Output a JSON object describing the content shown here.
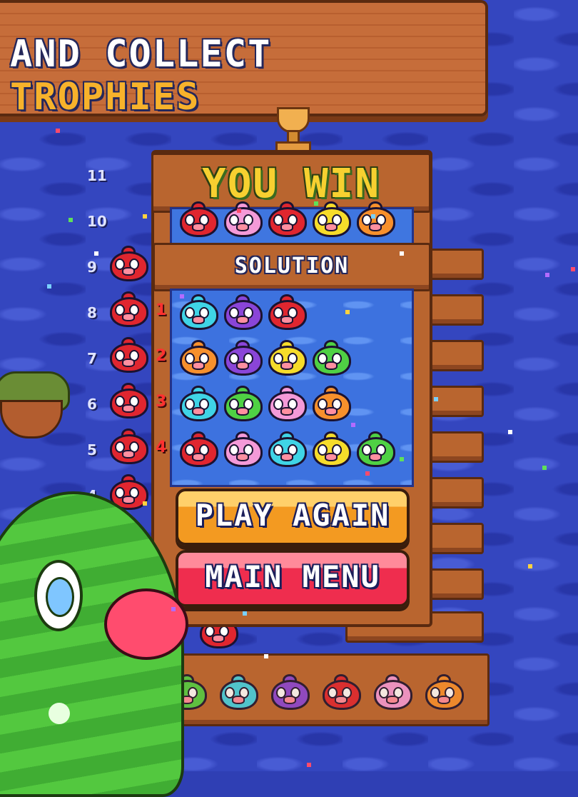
{
  "banner": {
    "text_plain": "AND COLLECT",
    "text_highlight": "TROPHIES"
  },
  "board": {
    "win_text": "YOU WIN",
    "solution_label": "SOLUTION",
    "answer_fish": [
      "red",
      "pink",
      "red",
      "yellow",
      "orange"
    ],
    "grid_rows": [
      {
        "rank": "1",
        "fish": [
          "cyan",
          "purple",
          "red"
        ]
      },
      {
        "rank": "2",
        "fish": [
          "orange",
          "purple",
          "yellow",
          "green"
        ]
      },
      {
        "rank": "3",
        "fish": [
          "cyan",
          "green",
          "pink",
          "orange"
        ]
      },
      {
        "rank": "4",
        "fish": [
          "red",
          "pink",
          "cyan",
          "yellow",
          "green"
        ]
      }
    ]
  },
  "row_numbers": [
    "11",
    "10",
    "9",
    "8",
    "7",
    "6",
    "5",
    "4"
  ],
  "buttons": {
    "play_again": "PLAY AGAIN",
    "main_menu": "MAIN MENU"
  },
  "palette_fish": [
    "green",
    "cyan",
    "purple",
    "red",
    "pink",
    "orange"
  ],
  "colors": {
    "red": "#e0262f",
    "pink": "#f49ad8",
    "yellow": "#f6dc2a",
    "orange": "#f7902c",
    "cyan": "#3fd4e6",
    "purple": "#8a45d8",
    "green": "#4fd144",
    "accent": "#f7b22b"
  }
}
